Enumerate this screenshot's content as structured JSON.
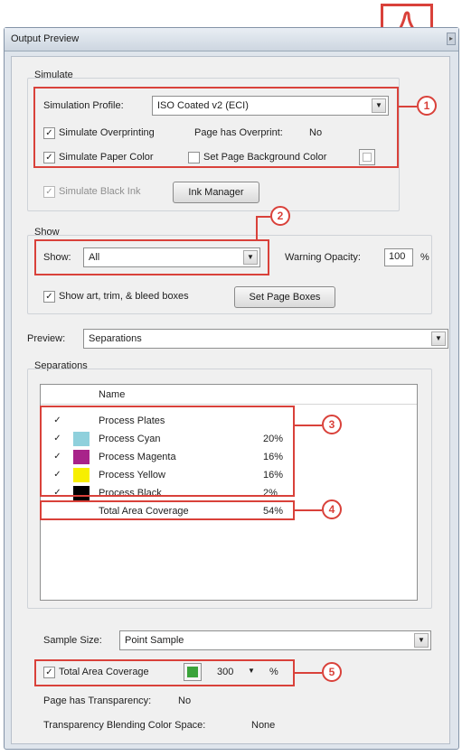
{
  "window": {
    "title": "Output Preview"
  },
  "simulate": {
    "group_label": "Simulate",
    "profile_label": "Simulation Profile:",
    "profile_value": "ISO Coated v2 (ECI)",
    "overprinting_label": "Simulate Overprinting",
    "overprinting_checked": "✓",
    "overprint_status_label": "Page has Overprint:",
    "overprint_status_value": "No",
    "paper_color_label": "Simulate Paper Color",
    "paper_color_checked": "✓",
    "bg_color_label": "Set Page Background Color",
    "black_ink_label": "Simulate Black Ink",
    "black_ink_checked": "✓",
    "ink_manager_label": "Ink Manager"
  },
  "show": {
    "group_label": "Show",
    "show_label": "Show:",
    "show_value": "All",
    "warning_opacity_label": "Warning Opacity:",
    "warning_opacity_value": "100",
    "percent": "%",
    "boxes_label": "Show art, trim, & bleed boxes",
    "boxes_checked": "✓",
    "set_page_boxes_label": "Set Page Boxes"
  },
  "preview": {
    "label": "Preview:",
    "value": "Separations"
  },
  "separations": {
    "group_label": "Separations",
    "column_name": "Name",
    "rows": [
      {
        "checked": "✓",
        "name": "Process Plates",
        "value": "",
        "color": ""
      },
      {
        "checked": "✓",
        "name": "Process Cyan",
        "value": "20%",
        "color": "#8fd0dc"
      },
      {
        "checked": "✓",
        "name": "Process Magenta",
        "value": "16%",
        "color": "#a8238a"
      },
      {
        "checked": "✓",
        "name": "Process Yellow",
        "value": "16%",
        "color": "#f7ef00"
      },
      {
        "checked": "✓",
        "name": "Process Black",
        "value": "2%",
        "color": "#000000"
      }
    ],
    "total_label": "Total Area Coverage",
    "total_value": "54%"
  },
  "sample": {
    "label": "Sample Size:",
    "value": "Point Sample"
  },
  "coverage": {
    "label": "Total Area Coverage",
    "checked": "✓",
    "swatch_color": "#3aa33a",
    "value": "300",
    "percent": "%"
  },
  "status": {
    "transparency_label": "Page has Transparency:",
    "transparency_value": "No",
    "blending_label": "Transparency Blending Color Space:",
    "blending_value": "None"
  },
  "callouts": [
    "1",
    "2",
    "3",
    "4",
    "5"
  ],
  "colors": {
    "callout": "#d9413a",
    "acrobat_red": "#d9413a"
  },
  "icons": {
    "logo": "acrobat-logo-icon",
    "dropdown": "chevron-down-icon"
  }
}
